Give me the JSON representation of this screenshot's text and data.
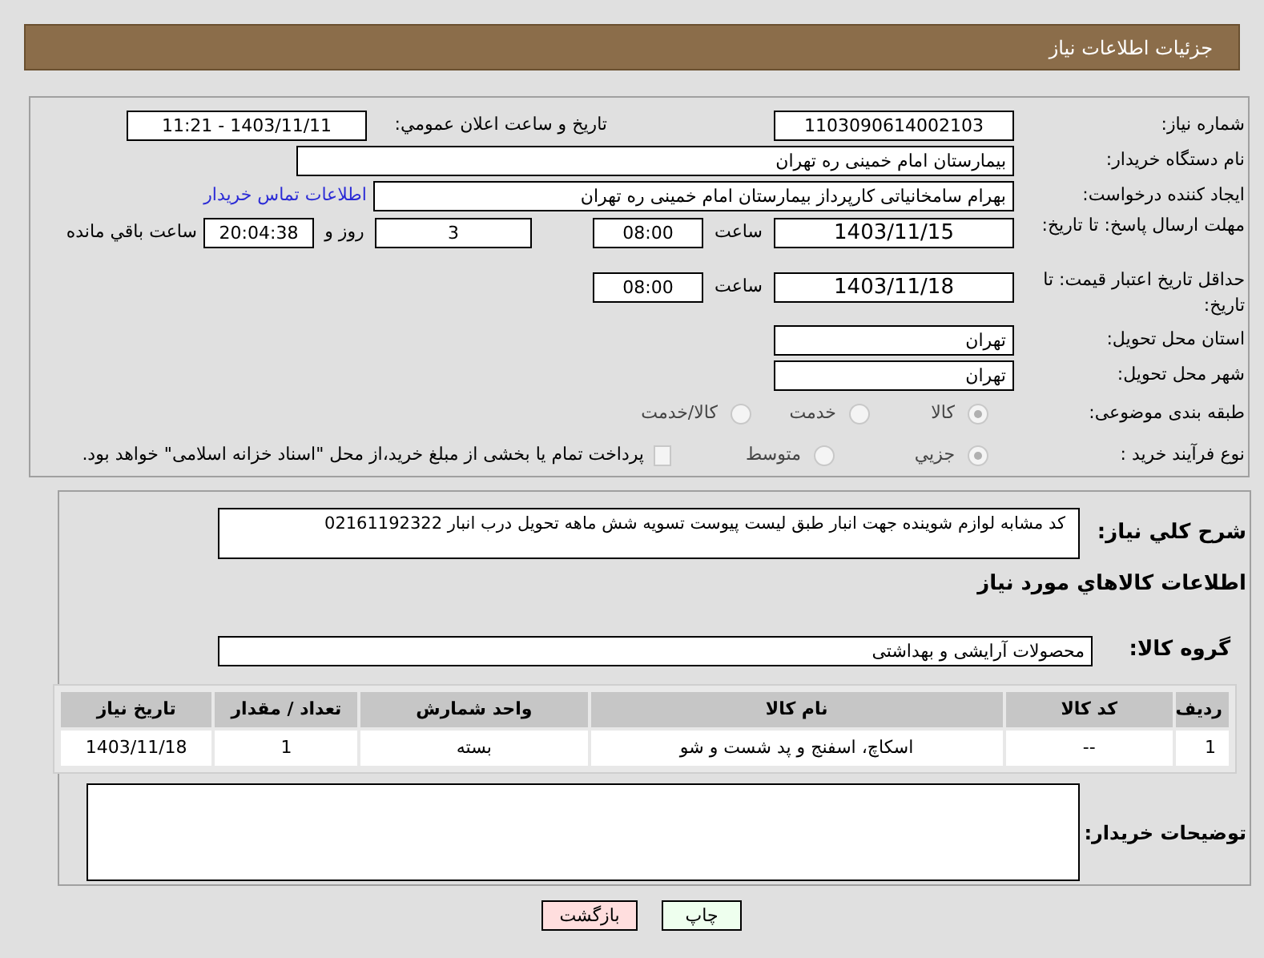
{
  "header": {
    "title": "جزئیات اطلاعات نیاز"
  },
  "need_number": {
    "label": "شماره نیاز:",
    "value": "1103090614002103"
  },
  "announce": {
    "label": "تاریخ و ساعت اعلان عمومي:",
    "value": "1403/11/11 - 11:21"
  },
  "buyer_org": {
    "label": "نام دستگاه خریدار:",
    "value": "بیمارستان امام خمینی ره  تهران"
  },
  "requester": {
    "label": "ایجاد کننده درخواست:",
    "value": "بهرام  سامخانیاتی  کارپرداز بیمارستان امام خمینی ره  تهران",
    "link": "اطلاعات تماس خریدار"
  },
  "reply_deadline": {
    "label": "مهلت ارسال پاسخ: تا تاریخ:",
    "date": "1403/11/15",
    "time_label": "ساعت",
    "time": "08:00",
    "days": "3",
    "days_label": "روز و",
    "remaining": "20:04:38",
    "remaining_label": "ساعت باقي مانده"
  },
  "validity": {
    "label": "حداقل تاریخ اعتبار قیمت: تا تاریخ:",
    "date": "1403/11/18",
    "time_label": "ساعت",
    "time": "08:00"
  },
  "province": {
    "label": "استان محل تحویل:",
    "value": "تهران"
  },
  "city": {
    "label": "شهر محل تحویل:",
    "value": "تهران"
  },
  "category": {
    "label": "طبقه بندی موضوعی:",
    "options": [
      {
        "label": "کالا",
        "selected": true
      },
      {
        "label": "خدمت",
        "selected": false
      },
      {
        "label": "کالا/خدمت",
        "selected": false
      }
    ]
  },
  "process": {
    "label": "نوع فرآیند خرید :",
    "options": [
      {
        "label": "جزيي",
        "selected": true
      },
      {
        "label": "متوسط",
        "selected": false
      }
    ],
    "treasury": {
      "checked": false,
      "text": "پرداخت تمام یا بخشی از مبلغ خرید،از محل \"اسناد خزانه اسلامی\" خواهد بود."
    }
  },
  "description": {
    "label": "شرح کلي نیاز:",
    "value": "کد مشابه لوازم شوینده جهت انبار طبق لیست پیوست تسویه شش ماهه تحویل درب انبار 02161192322"
  },
  "goods": {
    "heading": "اطلاعات کالاهاي مورد نیاز",
    "group_label": "گروه کالا:",
    "group_value": "محصولات آرایشی و بهداشتی",
    "columns": [
      "ردیف",
      "کد کالا",
      "نام کالا",
      "واحد شمارش",
      "تعداد / مقدار",
      "تاریخ نیاز"
    ],
    "rows": [
      [
        "1",
        "--",
        "اسکاچ، اسفنج و پد شست و شو",
        "بسته",
        "1",
        "1403/11/18"
      ]
    ]
  },
  "buyer_notes": {
    "label": "توضیحات خریدار:"
  },
  "buttons": [
    {
      "label": "چاپ",
      "kind": "print"
    },
    {
      "label": "بازگشت",
      "kind": "back"
    }
  ]
}
